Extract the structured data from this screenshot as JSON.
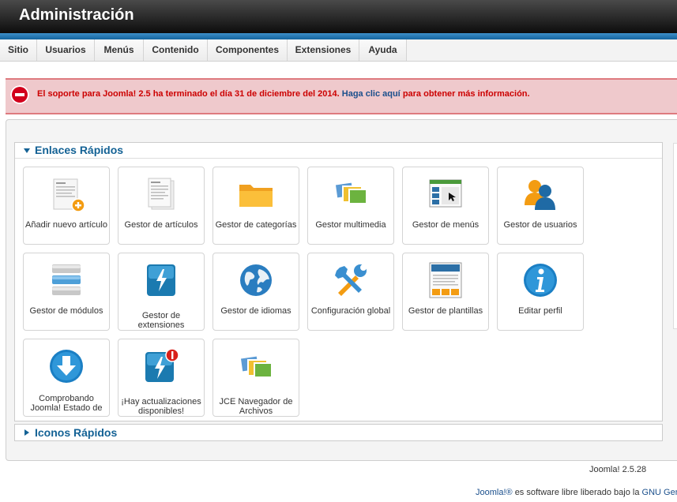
{
  "header": {
    "title": "Administración"
  },
  "menu": [
    "Sitio",
    "Usuarios",
    "Menús",
    "Contenido",
    "Componentes",
    "Extensiones",
    "Ayuda"
  ],
  "alert": {
    "text": "El soporte para Joomla! 2.5 ha terminado el día 31 de diciembre del 2014.",
    "link": "Haga clic aquí",
    "tail": "para obtener más información."
  },
  "quick_links": {
    "title": "Enlaces Rápidos",
    "tiles": [
      {
        "label": "Añadir nuevo artículo",
        "icon": "article-add-icon"
      },
      {
        "label": "Gestor de artículos",
        "icon": "article-icon"
      },
      {
        "label": "Gestor de categorías",
        "icon": "folder-icon"
      },
      {
        "label": "Gestor multimedia",
        "icon": "media-icon"
      },
      {
        "label": "Gestor de menús",
        "icon": "menu-icon"
      },
      {
        "label": "Gestor de usuarios",
        "icon": "users-icon"
      },
      {
        "label": "Gestor de módulos",
        "icon": "modules-icon"
      },
      {
        "label": "Gestor de extensiones",
        "icon": "extensions-icon"
      },
      {
        "label": "Gestor de idiomas",
        "icon": "globe-icon"
      },
      {
        "label": "Configuración global",
        "icon": "tools-icon"
      },
      {
        "label": "Gestor de plantillas",
        "icon": "template-icon"
      },
      {
        "label": "Editar perfil",
        "icon": "info-icon"
      },
      {
        "label": "Comprobando Joomla! Estado de",
        "icon": "download-icon"
      },
      {
        "label": "¡Hay actualizaciones disponibles!",
        "icon": "update-icon"
      },
      {
        "label": "JCE Navegador de Archivos",
        "icon": "jce-browser-icon"
      }
    ]
  },
  "quick_icons": {
    "title": "Iconos Rápidos"
  },
  "version": "Joomla! 2.5.28",
  "footer": {
    "brand": "Joomla!®",
    "text": "es software libre liberado bajo la",
    "link": "GNU Gen"
  },
  "colors": {
    "accent": "#146295",
    "alert_bg": "#efc9cc",
    "alert_text": "#cc0000"
  }
}
